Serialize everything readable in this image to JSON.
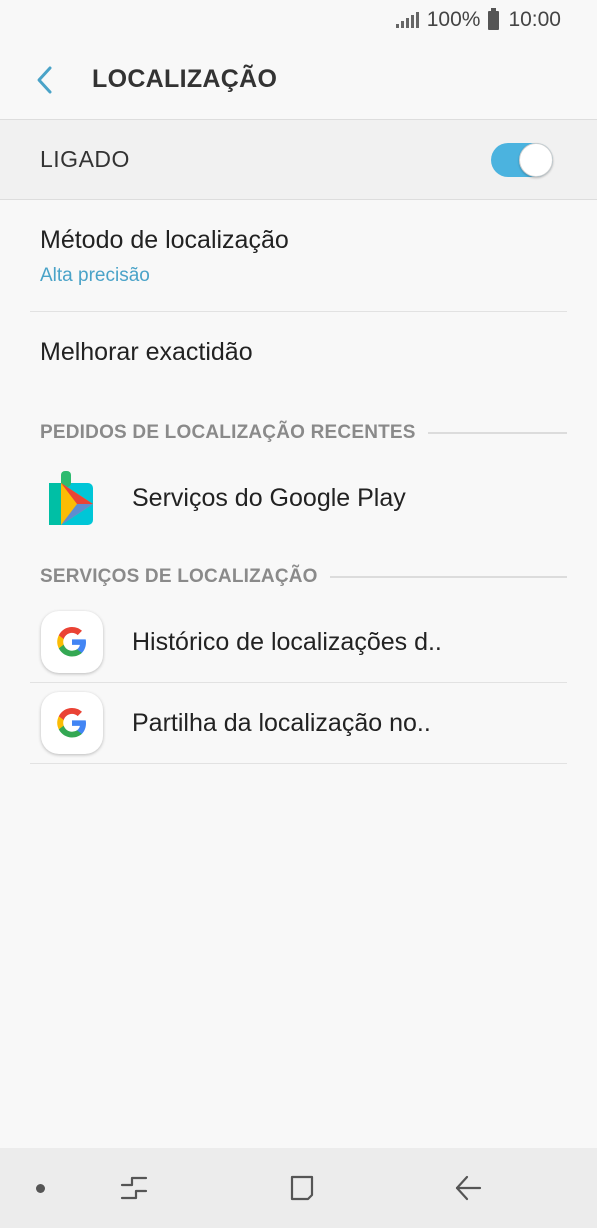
{
  "status_bar": {
    "battery": "100%",
    "time": "10:00"
  },
  "header": {
    "title": "LOCALIZAÇÃO",
    "back_icon": "chevron-left-icon"
  },
  "master_toggle": {
    "label": "LIGADO",
    "on": true,
    "accent": "#4bb3df"
  },
  "settings": [
    {
      "title": "Método de localização",
      "subtitle": "Alta precisão"
    },
    {
      "title": "Melhorar exactidão"
    }
  ],
  "recent_requests": {
    "header": "PEDIDOS DE LOCALIZAÇÃO RECENTES",
    "items": [
      {
        "label": "Serviços do Google Play",
        "icon": "google-play-services-icon"
      }
    ]
  },
  "location_services": {
    "header": "SERVIÇOS DE LOCALIZAÇÃO",
    "items": [
      {
        "label": "Histórico de localizações d..",
        "icon": "google-icon"
      },
      {
        "label": "Partilha da localização no..",
        "icon": "google-icon"
      }
    ]
  },
  "nav_bar": {
    "icons": [
      "nav-dot-icon",
      "recent-apps-icon",
      "home-icon",
      "back-icon"
    ]
  }
}
